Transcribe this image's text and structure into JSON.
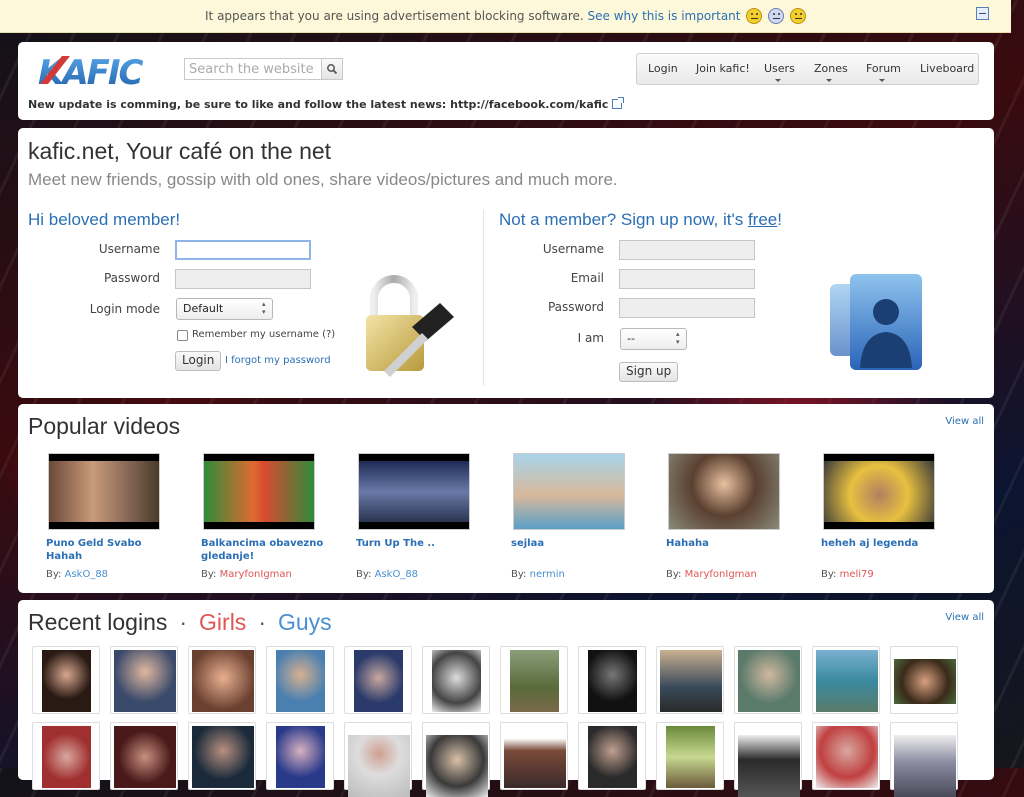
{
  "notice": {
    "text": "It appears that you are using advertisement blocking software.",
    "link": "See why this is important"
  },
  "header": {
    "logo_text": "KAFIC",
    "search_placeholder": "Search the website",
    "nav": [
      {
        "label": "Login",
        "dropdown": false
      },
      {
        "label": "Join kafic!",
        "dropdown": false
      },
      {
        "label": "Users",
        "dropdown": true
      },
      {
        "label": "Zones",
        "dropdown": true
      },
      {
        "label": "Forum",
        "dropdown": true
      },
      {
        "label": "Liveboard",
        "dropdown": false
      }
    ],
    "news": "New update is comming, be sure to like and follow the latest news: http://facebook.com/kafic"
  },
  "intro": {
    "title": "kafic.net, Your café on the net",
    "subtitle": "Meet new friends, gossip with old ones, share videos/pictures and much more.",
    "login": {
      "title": "Hi beloved member!",
      "username_label": "Username",
      "password_label": "Password",
      "mode_label": "Login mode",
      "mode_value": "Default",
      "remember_label": "Remember my username (?)",
      "login_button": "Login",
      "forgot_link": "I forgot my password"
    },
    "signup": {
      "title_prefix": "Not a member? Sign up now, it's ",
      "title_link": "free",
      "title_suffix": "!",
      "username_label": "Username",
      "email_label": "Email",
      "password_label": "Password",
      "iam_label": "I am",
      "iam_value": "--",
      "signup_button": "Sign up"
    }
  },
  "videos": {
    "title": "Popular videos",
    "view_all": "View all",
    "by_label": "By:",
    "items": [
      {
        "title": "Puno Geld Svabo Hahah",
        "user": "AskO_88",
        "user_color": "blue"
      },
      {
        "title": "Balkancima obavezno gledanje!",
        "user": "MaryfonIgman",
        "user_color": "red"
      },
      {
        "title": "Turn Up The ..",
        "user": "AskO_88",
        "user_color": "blue"
      },
      {
        "title": "sejlaa",
        "user": "nermin",
        "user_color": "blue"
      },
      {
        "title": "Hahaha",
        "user": "MaryfonIgman",
        "user_color": "red"
      },
      {
        "title": "heheh aj legenda",
        "user": "meli79",
        "user_color": "red"
      }
    ]
  },
  "logins": {
    "title": "Recent logins",
    "separator": "·",
    "girls": "Girls",
    "guys": "Guys",
    "view_all": "View all"
  }
}
